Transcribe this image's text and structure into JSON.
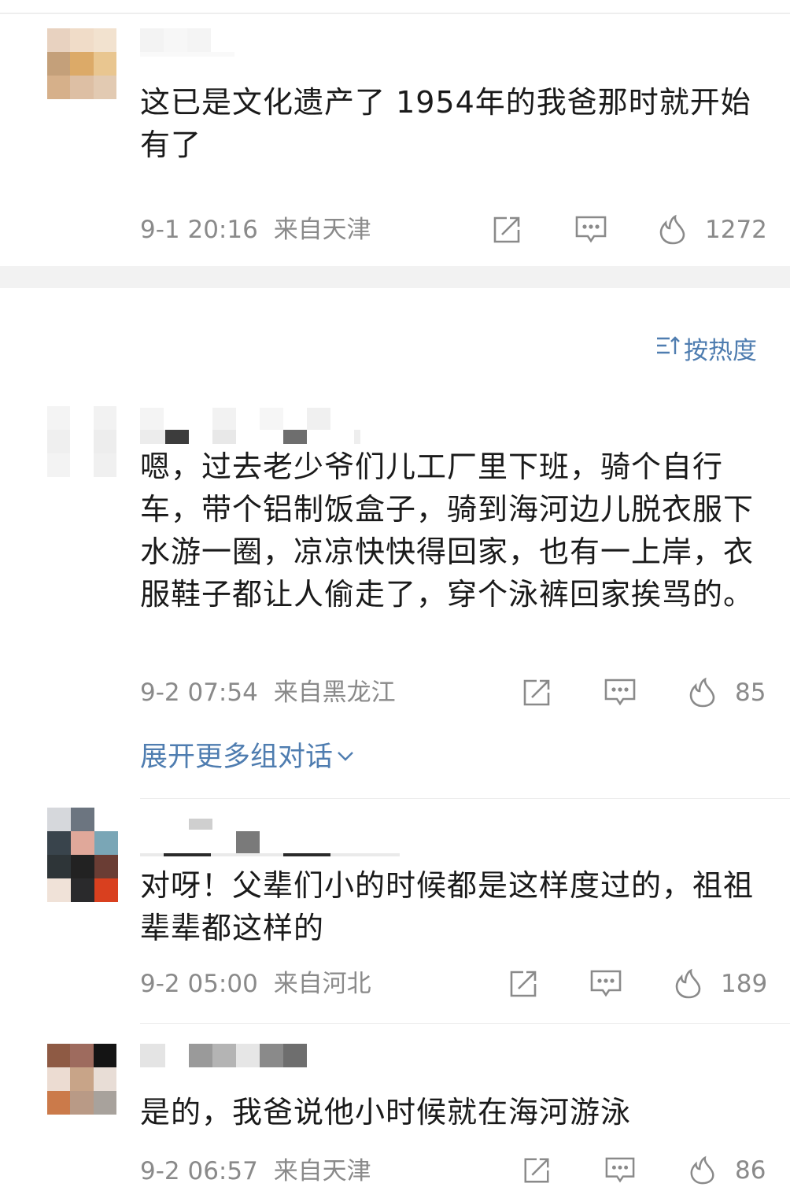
{
  "sort": {
    "label": "按热度"
  },
  "comments": [
    {
      "text": "这已是文化遗产了 1954年的我爸那时就开始有了",
      "time": "9-1 20:16",
      "location": "来自天津",
      "likes": "1272"
    },
    {
      "text": "嗯，过去老少爷们儿工厂里下班，骑个自行车，带个铝制饭盒子，骑到海河边儿脱衣服下水游一圈，凉凉快快得回家，也有一上岸，衣服鞋子都让人偷走了，穿个泳裤回家挨骂的。",
      "time": "9-2 07:54",
      "location": "来自黑龙江",
      "likes": "85"
    },
    {
      "text": "对呀！父辈们小的时候都是这样度过的，祖祖辈辈都这样的",
      "time": "9-2 05:00",
      "location": "来自河北",
      "likes": "189"
    },
    {
      "text": "是的，我爸说他小时候就在海河游泳",
      "time": "9-2 06:57",
      "location": "来自天津",
      "likes": "86"
    }
  ],
  "expand": {
    "label": "展开更多组对话"
  },
  "icons": {
    "share": "share-icon",
    "comment": "comment-icon",
    "like": "flame-icon"
  },
  "colors": {
    "link": "#4f7db0",
    "meta": "#8a8a8a",
    "text": "#1a1a1a"
  }
}
